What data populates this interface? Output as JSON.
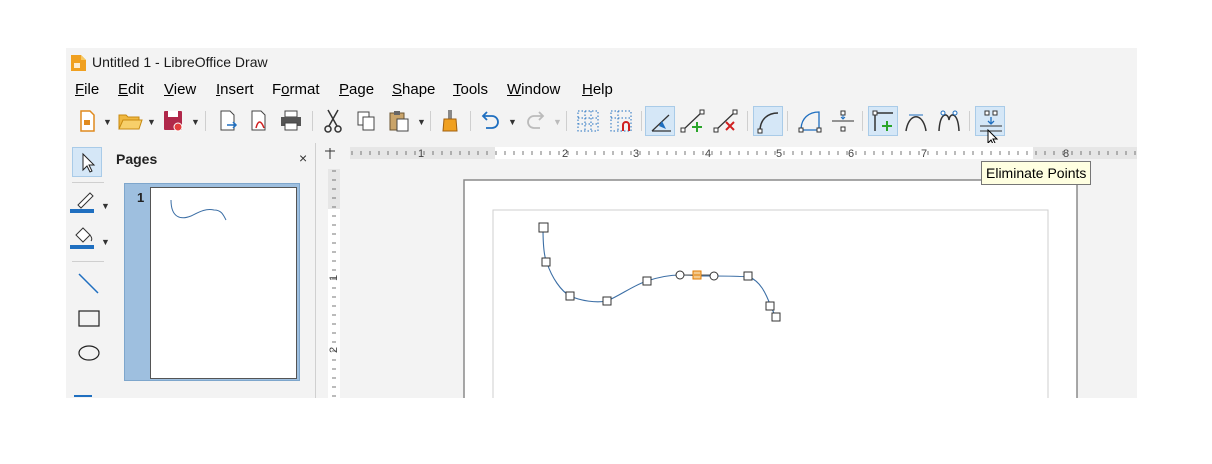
{
  "window": {
    "title": "Untitled 1 - LibreOffice Draw"
  },
  "menu": [
    {
      "label": "File",
      "u": "F",
      "rest": "ile"
    },
    {
      "label": "Edit",
      "u": "E",
      "rest": "dit"
    },
    {
      "label": "View",
      "u": "V",
      "rest": "iew"
    },
    {
      "label": "Insert",
      "u": "I",
      "rest": "nsert"
    },
    {
      "label": "Format",
      "pre": "F",
      "u": "o",
      "rest": "rmat"
    },
    {
      "label": "Page",
      "u": "P",
      "rest": "age"
    },
    {
      "label": "Shape",
      "u": "S",
      "rest": "hape"
    },
    {
      "label": "Tools",
      "u": "T",
      "rest": "ools"
    },
    {
      "label": "Window",
      "u": "W",
      "rest": "indow"
    },
    {
      "label": "Help",
      "u": "H",
      "rest": "elp"
    }
  ],
  "pages_panel": {
    "title": "Pages",
    "close": "×",
    "page_number": "1"
  },
  "ruler": {
    "h_labels": [
      "1",
      "2",
      "3",
      "4",
      "5",
      "6",
      "7",
      "8"
    ],
    "v_labels": [
      "1",
      "2"
    ]
  },
  "tooltip": {
    "text": "Eliminate Points"
  },
  "colors": {
    "accent": "#1f6fc0",
    "curve": "#3b6ea5",
    "selected_point": "#e07b00",
    "active_button_bg": "#d5e7f7"
  },
  "icons": {
    "toolbar": [
      "new-icon",
      "open-icon",
      "save-icon",
      "export-icon",
      "export-pdf-icon",
      "print-icon",
      "cut-icon",
      "copy-icon",
      "paste-icon",
      "clone-formatting-icon",
      "undo-icon",
      "redo-icon",
      "grid-icon",
      "snap-grid-icon",
      "edit-points-icon",
      "insert-points-icon",
      "delete-points-icon",
      "convert-to-curve-icon",
      "close-bezier-icon",
      "split-curve-icon",
      "corner-point-icon",
      "smooth-transition-icon",
      "symmetric-transition-icon",
      "eliminate-points-icon"
    ],
    "left": [
      "select-icon",
      "line-color-icon",
      "fill-color-icon",
      "line-tool-icon",
      "rectangle-icon",
      "ellipse-icon"
    ]
  }
}
